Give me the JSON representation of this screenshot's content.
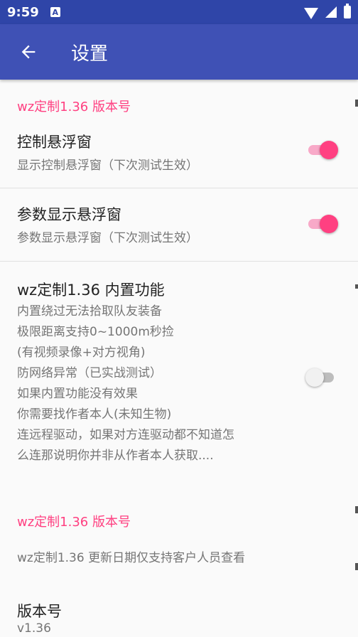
{
  "status_bar": {
    "time": "9:59",
    "notification_icon": "A"
  },
  "app_bar": {
    "title": "设置"
  },
  "sections": {
    "header1": "wz定制1.36 版本号",
    "float_control": {
      "title": "控制悬浮窗",
      "summary": "显示控制悬浮窗（下次测试生效）",
      "enabled": true
    },
    "param_float": {
      "title": "参数显示悬浮窗",
      "summary": "参数显示悬浮窗（下次测试生效）",
      "enabled": true
    },
    "builtin": {
      "title": "wz定制1.36 内置功能",
      "lines": [
        "内置绕过无法拾取队友装备",
        "极限距离支持0~1000m秒捡",
        "(有视频录像+对方视角)",
        "防网络异常（已实战测试）",
        "如果内置功能没有效果",
        "你需要找作者本人(未知生物)",
        "连远程驱动，如果对方连驱动都不知道怎",
        "么连那说明你并非从作者本人获取...."
      ],
      "enabled": false
    },
    "header2": "wz定制1.36 版本号",
    "update_note": "wz定制1.36 更新日期仅支持客户人员查看",
    "version": {
      "title": "版本号",
      "value": "v1.36"
    }
  },
  "colors": {
    "status_bar": "#2f45a8",
    "app_bar": "#3f51b5",
    "accent": "#ff4081"
  }
}
